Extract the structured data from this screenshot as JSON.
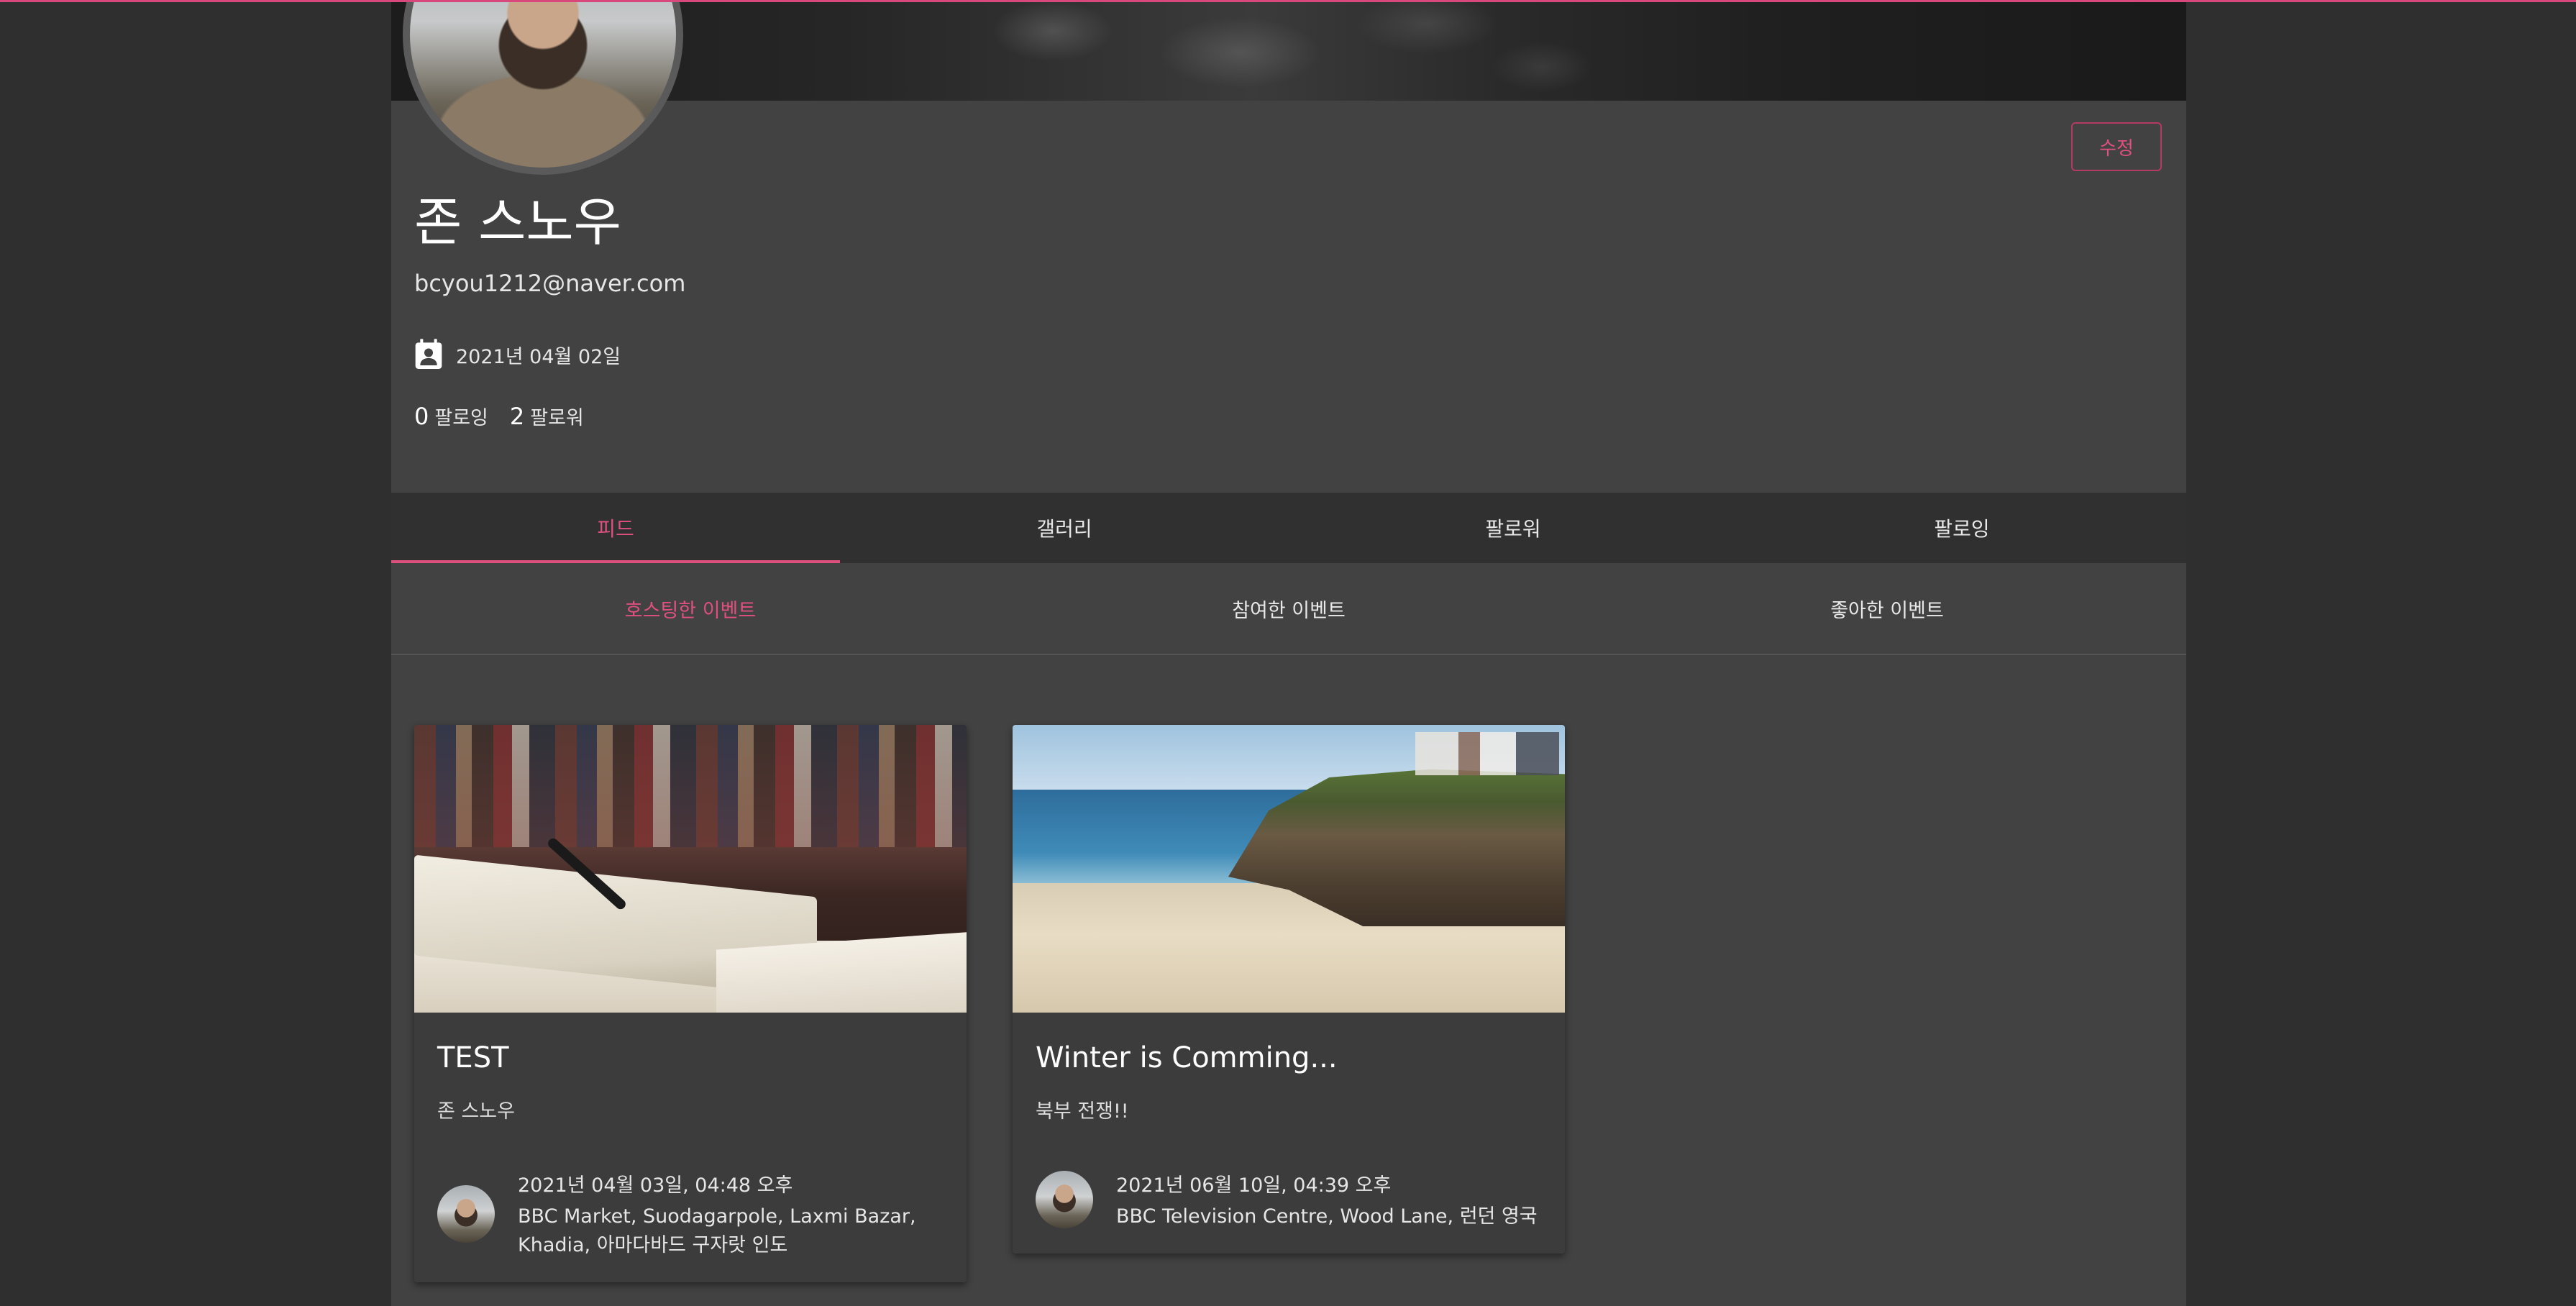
{
  "profile": {
    "name": "존 스노우",
    "email": "bcyou1212@naver.com",
    "joined": "2021년 04월 02일",
    "following_count": "0",
    "following_label": "팔로잉",
    "followers_count": "2",
    "followers_label": "팔로워",
    "edit_label": "수정"
  },
  "tabs": [
    {
      "label": "피드",
      "active": true
    },
    {
      "label": "갤러리",
      "active": false
    },
    {
      "label": "팔로워",
      "active": false
    },
    {
      "label": "팔로잉",
      "active": false
    }
  ],
  "subtabs": [
    {
      "label": "호스팅한 이벤트",
      "active": true
    },
    {
      "label": "참여한 이벤트",
      "active": false
    },
    {
      "label": "좋아한 이벤트",
      "active": false
    }
  ],
  "events": [
    {
      "title": "TEST",
      "subtitle": "존 스노우",
      "datetime": "2021년 04월 03일, 04:48 오후",
      "location": "BBC Market, Suodagarpole, Laxmi Bazar, Khadia, 아마다바드 구자랏 인도"
    },
    {
      "title": "Winter is Comming...",
      "subtitle": "북부 전쟁!!",
      "datetime": "2021년 06월 10일, 04:39 오후",
      "location": "BBC Television Centre, Wood Lane, 런던 영국"
    }
  ],
  "colors": {
    "accent": "#e0507f",
    "background": "#2f2f2f",
    "panel": "#424242",
    "tabbar": "#303030",
    "card": "#3c3c3c"
  },
  "icons": {
    "joined": "calendar-account-icon"
  }
}
